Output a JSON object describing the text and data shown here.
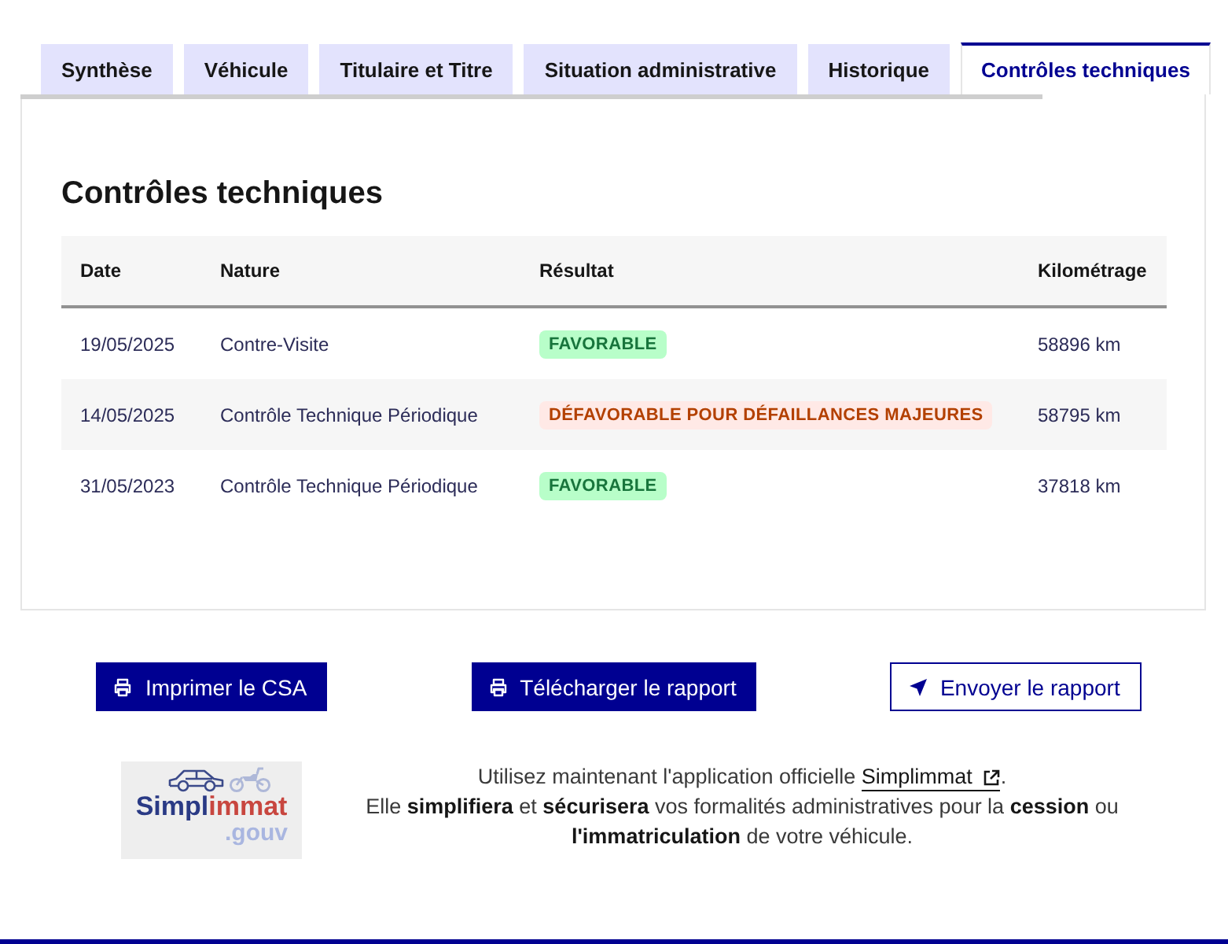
{
  "tabs": [
    {
      "label": "Synthèse",
      "selected": false
    },
    {
      "label": "Véhicule",
      "selected": false
    },
    {
      "label": "Titulaire et Titre",
      "selected": false
    },
    {
      "label": "Situation administrative",
      "selected": false
    },
    {
      "label": "Historique",
      "selected": false
    },
    {
      "label": "Contrôles techniques",
      "selected": true
    }
  ],
  "section": {
    "title": "Contrôles techniques"
  },
  "table": {
    "columns": [
      "Date",
      "Nature",
      "Résultat",
      "Kilométrage"
    ],
    "rows": [
      {
        "date": "19/05/2025",
        "nature": "Contre-Visite",
        "result": {
          "label": "FAVORABLE",
          "kind": "success"
        },
        "mileage": "58896 km"
      },
      {
        "date": "14/05/2025",
        "nature": "Contrôle Technique Périodique",
        "result": {
          "label": "DÉFAVORABLE POUR DÉFAILLANCES MAJEURES",
          "kind": "error"
        },
        "mileage": "58795 km"
      },
      {
        "date": "31/05/2023",
        "nature": "Contrôle Technique Périodique",
        "result": {
          "label": "FAVORABLE",
          "kind": "success"
        },
        "mileage": "37818 km"
      }
    ]
  },
  "actions": [
    {
      "label": "Imprimer le CSA",
      "kind": "primary"
    },
    {
      "label": "Télécharger le rapport",
      "kind": "primary"
    },
    {
      "label": "Envoyer le rapport",
      "kind": "secondary"
    }
  ],
  "promo": {
    "logo": {
      "wordmark_main": "Simpl",
      "wordmark_accent": "immat",
      "domain": ".gouv"
    },
    "intro": "Utilisez maintenant l'application officielle",
    "link": "Simplimmat",
    "intro_end": ".",
    "description": "Elle **simplifiera** et **sécurisera** vos formalités administratives pour la **cession** ou **l'immatriculation** de votre véhicule."
  }
}
